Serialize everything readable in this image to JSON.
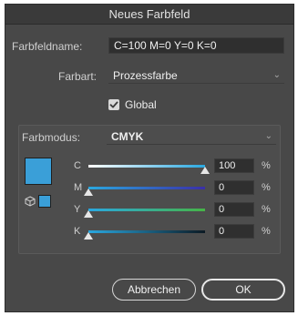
{
  "window": {
    "title": "Neues Farbfeld"
  },
  "fields": {
    "name_label": "Farbfeldname:",
    "name_value": "C=100 M=0 Y=0 K=0",
    "type_label": "Farbart:",
    "type_value": "Prozessfarbe",
    "global_label": "Global",
    "global_checked": true,
    "mode_label": "Farbmodus:",
    "mode_value": "CMYK"
  },
  "colors": {
    "swatch": "#3a9fd8",
    "cyan_track": "#2aa8e0",
    "magenta_track": "#4b3fb0",
    "yellow_track": "#46b447",
    "black_track": "#1a1a1a"
  },
  "channels": [
    {
      "label": "C",
      "value": "100",
      "percent": 100,
      "unit": "%"
    },
    {
      "label": "M",
      "value": "0",
      "percent": 0,
      "unit": "%"
    },
    {
      "label": "Y",
      "value": "0",
      "percent": 0,
      "unit": "%"
    },
    {
      "label": "K",
      "value": "0",
      "percent": 0,
      "unit": "%"
    }
  ],
  "icons": {
    "gamut": "cube-icon",
    "dropdown": "chevron-down-icon",
    "check": "checkmark-icon"
  },
  "buttons": {
    "cancel": "Abbrechen",
    "ok": "OK"
  }
}
